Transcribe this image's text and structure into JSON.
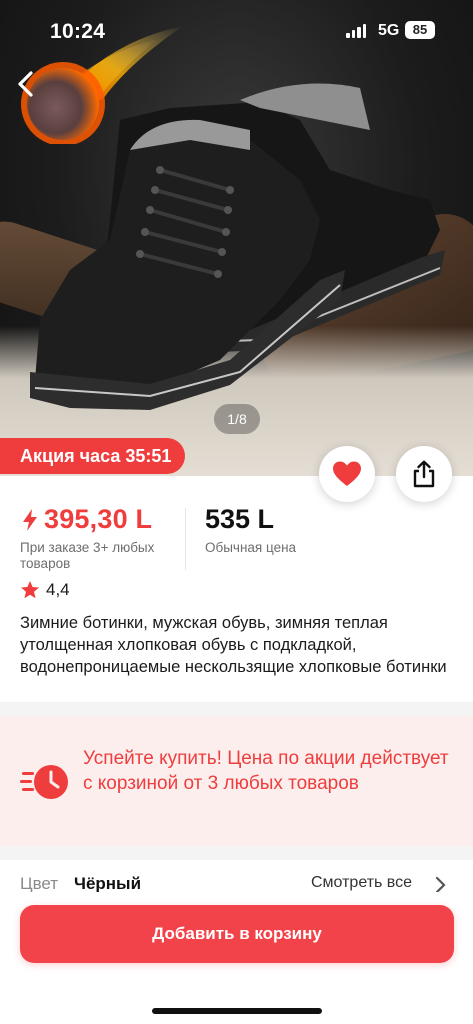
{
  "status_bar": {
    "time": "10:24",
    "network": "5G",
    "battery": "85"
  },
  "gallery": {
    "counter": "1/8",
    "icon_back": "chevron-left-icon"
  },
  "promo": {
    "timer_label": "Акция часа 35:51"
  },
  "actions": {
    "favorite_icon": "heart-icon",
    "share_icon": "share-icon"
  },
  "price": {
    "sale_value": "395,30 L",
    "sale_caption": "При заказе 3+ любых товаров",
    "regular_value": "535 L",
    "regular_caption": "Обычная цена"
  },
  "rating": {
    "value": "4,4"
  },
  "product": {
    "title": "Зимние ботинки, мужская обувь, зимняя теплая утолщенная хлопковая обувь с подкладкой, водонепроницаемые нескользящие хлопковые ботинки"
  },
  "notice": {
    "text": "Успейте купить! Цена по акции действует с корзиной от 3 любых товаров"
  },
  "variant": {
    "label": "Цвет",
    "value": "Чёрный",
    "see_all": "Смотреть все"
  },
  "cart": {
    "button_label": "Добавить в корзину"
  },
  "colors": {
    "accent": "#ef3d3d",
    "notice_bg": "#fdeeee"
  }
}
